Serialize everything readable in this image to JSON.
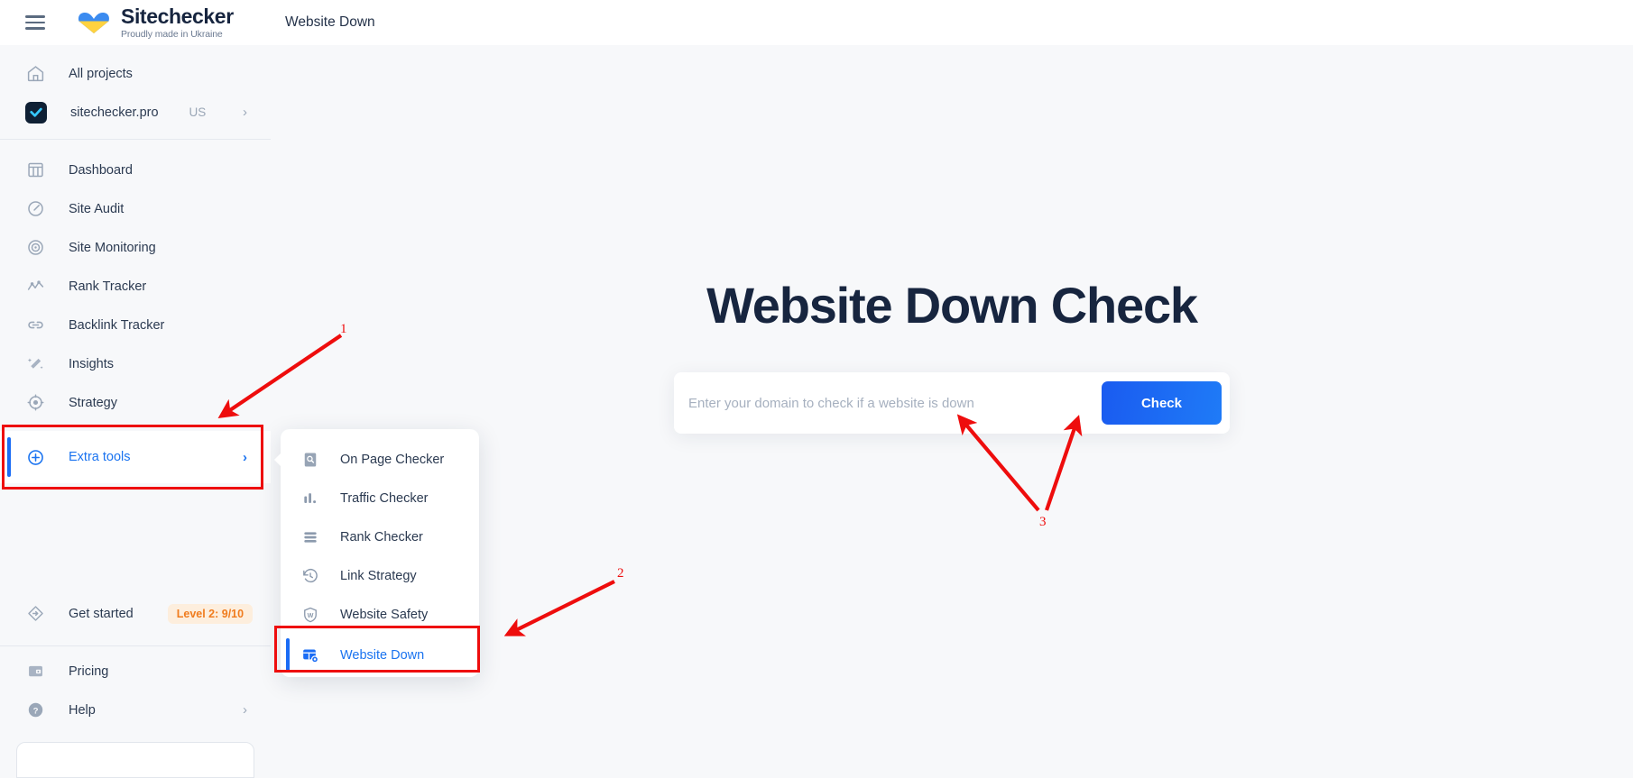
{
  "brand": {
    "name": "Sitechecker",
    "tagline": "Proudly made in Ukraine",
    "menu_icon": "hamburger-icon",
    "logo_icon": "heart-flag-icon"
  },
  "topbar": {
    "title": "Website Down"
  },
  "sidebar": {
    "projects": [
      {
        "label": "All projects",
        "icon": "home-icon"
      },
      {
        "label": "sitechecker.pro",
        "sub": "US",
        "icon": "project-avatar-icon",
        "chevron": "›"
      }
    ],
    "nav": [
      {
        "label": "Dashboard",
        "icon": "dashboard-icon"
      },
      {
        "label": "Site Audit",
        "icon": "site-audit-icon"
      },
      {
        "label": "Site Monitoring",
        "icon": "site-monitoring-icon"
      },
      {
        "label": "Rank Tracker",
        "icon": "rank-tracker-icon"
      },
      {
        "label": "Backlink Tracker",
        "icon": "backlink-tracker-icon"
      },
      {
        "label": "Insights",
        "icon": "insights-icon"
      },
      {
        "label": "Strategy",
        "icon": "strategy-icon"
      }
    ],
    "extra_tools": {
      "label": "Extra tools",
      "icon": "plus-circle-icon",
      "chevron": "›"
    },
    "get_started": {
      "label": "Get started",
      "icon": "get-started-icon",
      "badge": "Level 2: 9/10"
    },
    "footer": [
      {
        "label": "Pricing",
        "icon": "pricing-icon"
      },
      {
        "label": "Help",
        "icon": "help-icon",
        "chevron": "›"
      }
    ]
  },
  "flyout": {
    "items": [
      {
        "label": "On Page Checker",
        "icon": "on-page-checker-icon",
        "active": false
      },
      {
        "label": "Traffic Checker",
        "icon": "traffic-checker-icon",
        "active": false
      },
      {
        "label": "Rank Checker",
        "icon": "rank-checker-icon",
        "active": false
      },
      {
        "label": "Link Strategy",
        "icon": "link-strategy-icon",
        "active": false
      },
      {
        "label": "Website Safety",
        "icon": "website-safety-icon",
        "active": false
      },
      {
        "label": "Website Down",
        "icon": "website-down-icon",
        "active": true
      }
    ]
  },
  "main": {
    "heading": "Website Down Check",
    "search_placeholder": "Enter your domain to check if a website is down",
    "search_value": "",
    "check_label": "Check"
  },
  "annotations": {
    "numbers": [
      "1",
      "2",
      "3"
    ],
    "color": "#ee0d0d"
  },
  "colors": {
    "accent_blue": "#1a73f0",
    "annotation_red": "#ee0d0d",
    "badge_orange": "#f07c1e",
    "sidebar_bg": "#f7f8fa",
    "text_dark": "#17253f"
  }
}
